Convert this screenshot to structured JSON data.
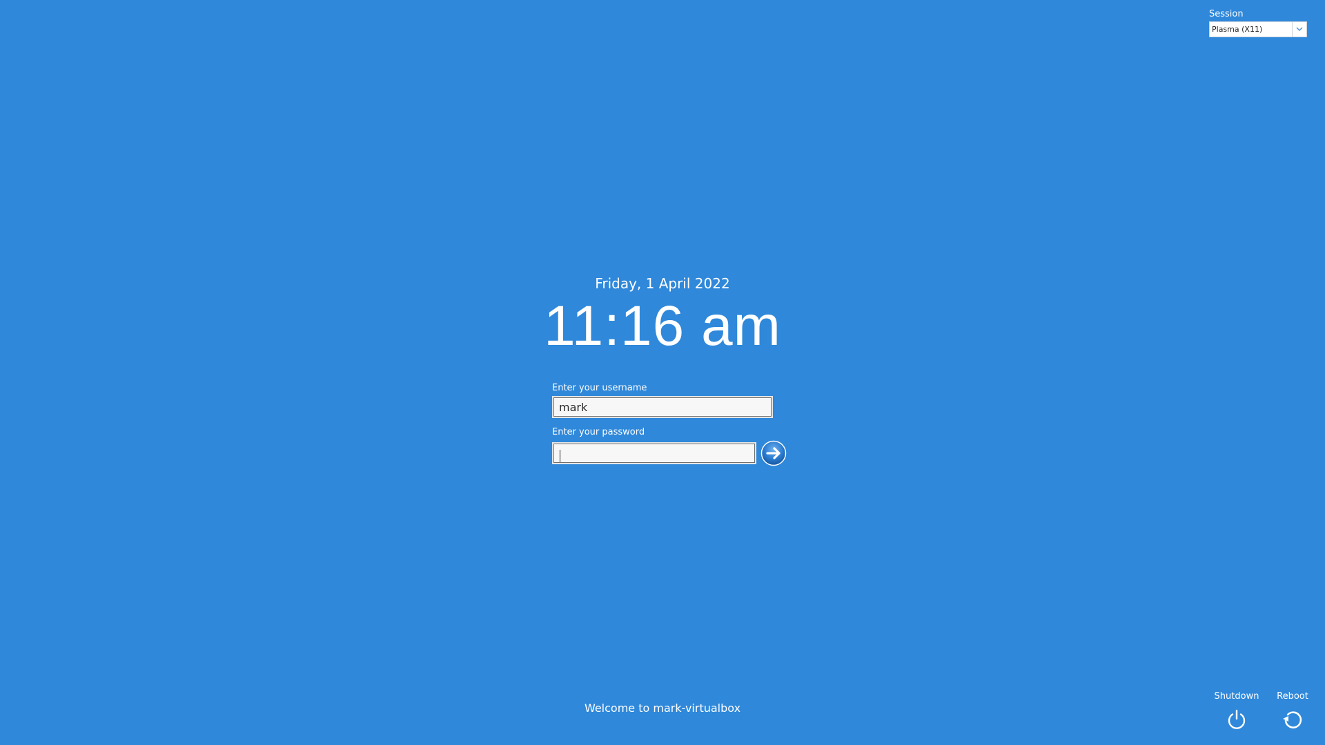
{
  "session": {
    "label": "Session",
    "selected": "Plasma (X11)"
  },
  "clock": {
    "date": "Friday, 1 April 2022",
    "time": "11:16 am"
  },
  "login": {
    "username_label": "Enter your username",
    "username_value": "mark",
    "password_label": "Enter your password",
    "password_value": ""
  },
  "welcome": "Welcome to mark-virtualbox",
  "power": {
    "shutdown_label": "Shutdown",
    "reboot_label": "Reboot"
  },
  "colors": {
    "background": "#2f88da",
    "text": "#ffffff",
    "login_button": "#1f6fc0"
  },
  "icons": {
    "session_dropdown": "chevron-down-icon",
    "login": "arrow-right-icon",
    "shutdown": "power-icon",
    "reboot": "reboot-icon"
  }
}
